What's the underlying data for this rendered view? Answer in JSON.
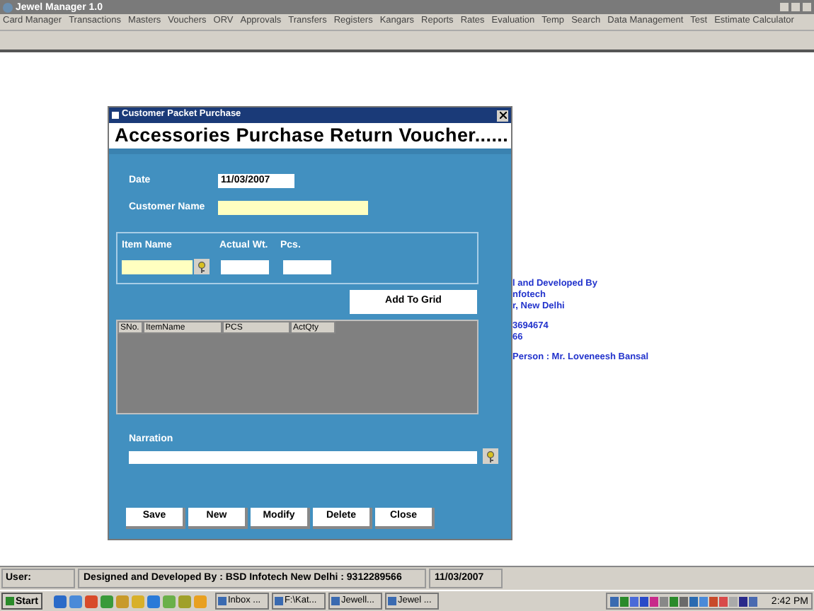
{
  "window": {
    "title": "Jewel Manager 1.0"
  },
  "menu": [
    "Card Manager",
    "Transactions",
    "Masters",
    "Vouchers",
    "ORV",
    "Approvals",
    "Transfers",
    "Registers",
    "Kangars",
    "Reports",
    "Rates",
    "Evaluation",
    "Temp",
    "Search",
    "Data Management",
    "Test",
    "Estimate Calculator"
  ],
  "background_text": [
    [
      "l and Developed By",
      "nfotech",
      "r, New Delhi"
    ],
    [
      "3694674",
      "66"
    ],
    [
      "Person : Mr. Loveneesh Bansal"
    ]
  ],
  "dialog": {
    "title": "Customer Packet Purchase",
    "heading": "Accessories Purchase Return Voucher......",
    "date_label": "Date",
    "date_value": "11/03/2007",
    "customer_label": "Customer Name",
    "item_label": "Item Name",
    "weight_label": "Actual Wt.",
    "pcs_label": "Pcs.",
    "add_button": "Add To Grid",
    "grid_columns": [
      "SNo.",
      "ItemName",
      "PCS",
      "ActQty"
    ],
    "narration_label": "Narration",
    "buttons": [
      "Save",
      "New",
      "Modify",
      "Delete",
      "Close"
    ]
  },
  "status_bar": [
    "User:",
    "Designed and Developed By : BSD Infotech New Delhi : 9312289566",
    "11/03/2007"
  ],
  "taskbar": {
    "start": "Start",
    "tasks": [
      "Inbox ...",
      "F:\\Kat...",
      "Jewell...",
      "Jewel ..."
    ],
    "clock": "2:42 PM"
  }
}
